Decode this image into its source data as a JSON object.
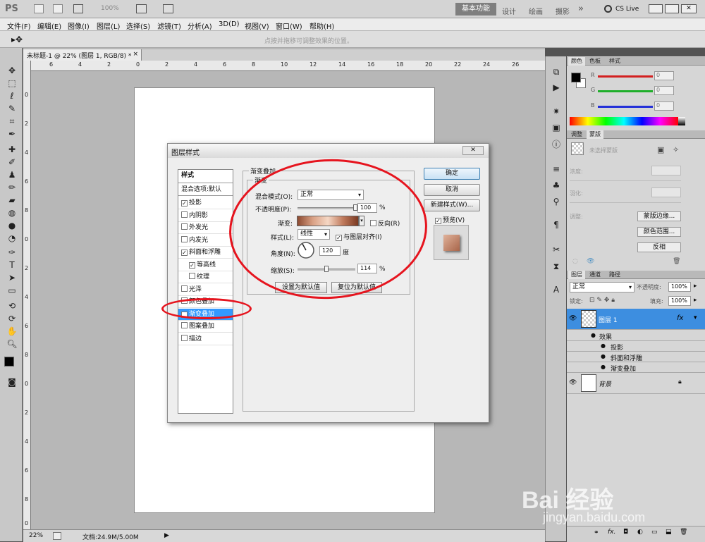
{
  "app": {
    "logo": "PS",
    "zoom_top": "100%",
    "workspaces": [
      "基本功能",
      "设计",
      "绘画",
      "摄影"
    ],
    "more": "»",
    "cslive": "CS Live"
  },
  "menus": [
    "文件(F)",
    "编辑(E)",
    "图像(I)",
    "图层(L)",
    "选择(S)",
    "滤镜(T)",
    "分析(A)",
    "3D(D)",
    "视图(V)",
    "窗口(W)",
    "帮助(H)"
  ],
  "options": {
    "hint": "点按并拖移可调整效果的位置。"
  },
  "document": {
    "tab_title": "未标题-1 @ 22% (图层 1, RGB/8) *",
    "ruler_h": [
      "6",
      "4",
      "2",
      "0",
      "2",
      "4",
      "6",
      "8",
      "10",
      "12",
      "14",
      "16",
      "18",
      "20",
      "22",
      "24",
      "26"
    ],
    "ruler_v": [
      "0",
      "2",
      "4",
      "6",
      "8",
      "0",
      "2",
      "4",
      "6",
      "8",
      "0",
      "2",
      "4",
      "6",
      "8",
      "0"
    ]
  },
  "status": {
    "zoom": "22%",
    "doc": "文档:24.9M/5.00M"
  },
  "color_panel": {
    "tabs": [
      "颜色",
      "色板",
      "样式"
    ],
    "channels": [
      {
        "label": "R",
        "value": "0",
        "color": "#d32020"
      },
      {
        "label": "G",
        "value": "0",
        "color": "#1fae2a"
      },
      {
        "label": "B",
        "value": "0",
        "color": "#2430d8"
      }
    ]
  },
  "adjust_panel": {
    "tabs": [
      "调整",
      "蒙版"
    ],
    "no_mask": "未选择蒙版",
    "density": "浓度:",
    "feather": "羽化:",
    "refine": "调整:",
    "buttons": [
      "蒙版边缘...",
      "颜色范围...",
      "反相"
    ]
  },
  "layers_panel": {
    "tabs": [
      "图层",
      "通道",
      "路径"
    ],
    "blend": "正常",
    "opacity_label": "不透明度:",
    "opacity": "100%",
    "lock_label": "锁定:",
    "fill_label": "填充:",
    "fill": "100%",
    "layer1": "图层 1",
    "fx": "fx",
    "effects": "效果",
    "effect_items": [
      "投影",
      "斜面和浮雕",
      "渐变叠加"
    ],
    "background": "背景"
  },
  "dialog": {
    "title": "图层样式",
    "close": "✕",
    "styles_header": "样式",
    "blend_options": "混合选项:默认",
    "styles": [
      {
        "label": "投影",
        "checked": true,
        "indent": false
      },
      {
        "label": "内阴影",
        "checked": false,
        "indent": false
      },
      {
        "label": "外发光",
        "checked": false,
        "indent": false
      },
      {
        "label": "内发光",
        "checked": false,
        "indent": false
      },
      {
        "label": "斜面和浮雕",
        "checked": true,
        "indent": false
      },
      {
        "label": "等高线",
        "checked": true,
        "indent": true
      },
      {
        "label": "纹理",
        "checked": false,
        "indent": true
      },
      {
        "label": "光泽",
        "checked": false,
        "indent": false
      },
      {
        "label": "颜色叠加",
        "checked": false,
        "indent": false
      },
      {
        "label": "渐变叠加",
        "checked": true,
        "indent": false
      },
      {
        "label": "图案叠加",
        "checked": false,
        "indent": false
      },
      {
        "label": "描边",
        "checked": false,
        "indent": false
      }
    ],
    "section_title": "渐变叠加",
    "sub_title": "渐变",
    "blend_mode_label": "混合模式(O):",
    "blend_mode": "正常",
    "opacity_label": "不透明度(P):",
    "opacity": "100",
    "opacity_level": 1.0,
    "pct": "%",
    "gradient_label": "渐变:",
    "reverse": "反向(R)",
    "style_label": "样式(L):",
    "style": "线性",
    "align": "与图层对齐(I)",
    "angle_label": "角度(N):",
    "angle": "120",
    "degree": "度",
    "scale_label": "缩放(S):",
    "scale": "114",
    "scale_level": 0.5,
    "set_default": "设置为默认值",
    "reset_default": "复位为默认值",
    "ok": "确定",
    "cancel": "取消",
    "new_style": "新建样式(W)...",
    "preview": "预览(V)"
  },
  "watermark": {
    "line1": "Bai 经验",
    "line2": "jingyan.baidu.com"
  }
}
